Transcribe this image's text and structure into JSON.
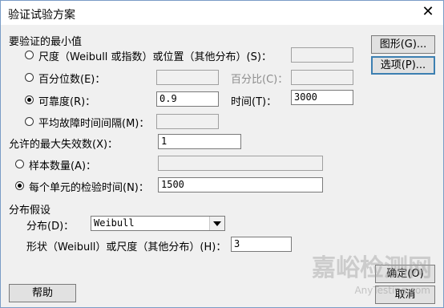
{
  "window": {
    "title": "验证试验方案",
    "close_glyph": "✕"
  },
  "section_min": {
    "heading": "要验证的最小值",
    "shape_scale": {
      "label": "尺度（Weibull 或指数）或位置（其他分布）(S)：",
      "value": ""
    },
    "percentile": {
      "label": "百分位数(E)：",
      "value": ""
    },
    "percent": {
      "label": "百分比(C)：",
      "value": ""
    },
    "reliability": {
      "label": "可靠度(R)：",
      "value": "0.9"
    },
    "time": {
      "label": "时间(T)：",
      "value": "3000"
    },
    "mtbf": {
      "label": "平均故障时间间隔(M)：",
      "value": ""
    }
  },
  "max_failures": {
    "label": "允许的最大失效数(X)：",
    "value": "1"
  },
  "sample_size": {
    "label": "样本数量(A)：",
    "value": ""
  },
  "test_time": {
    "label": "每个单元的检验时间(N)：",
    "value": "1500"
  },
  "distribution": {
    "heading": "分布假设",
    "dist_label": "分布(D)：",
    "dist_value": "Weibull",
    "shape_label": "形状（Weibull）或尺度（其他分布）(H)：",
    "shape_value": "3"
  },
  "buttons": {
    "graph": "图形(G)...",
    "options": "选项(P)...",
    "help": "帮助",
    "ok": "确定(O)",
    "cancel": "取消"
  },
  "watermark": {
    "text": "嘉峪检测网",
    "url": "AnyTesting.com"
  }
}
